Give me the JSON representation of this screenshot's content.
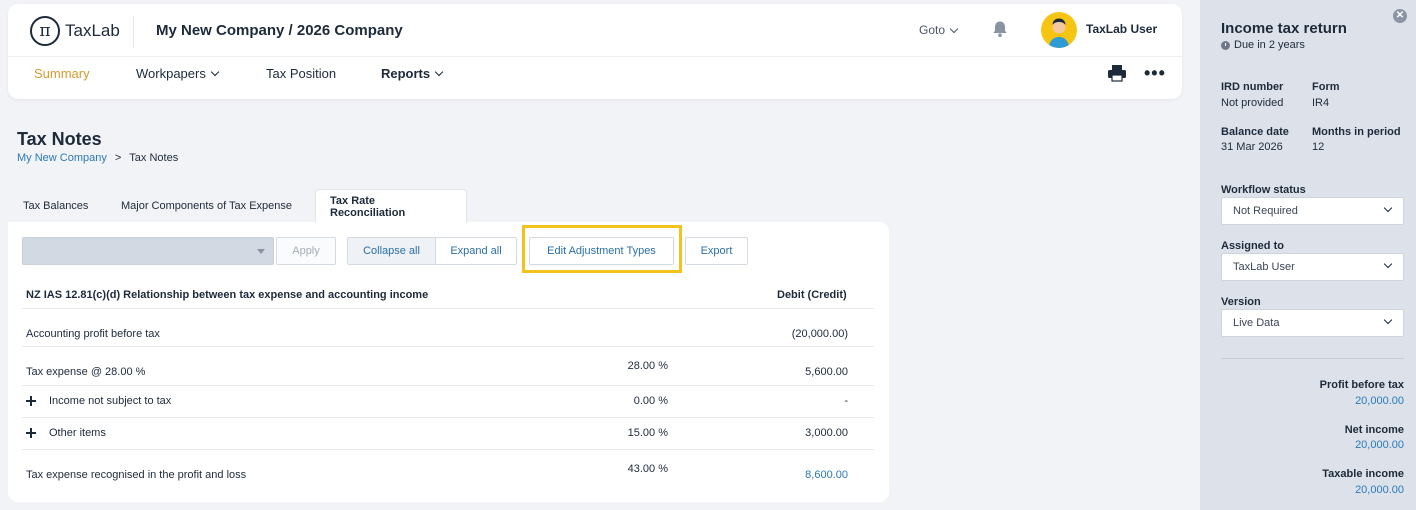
{
  "header": {
    "logo_text": "TaxLab",
    "company_title": "My New Company / 2026 Company",
    "goto_label": "Goto",
    "user_name": "TaxLab User"
  },
  "nav": [
    {
      "label": "Summary"
    },
    {
      "label": "Workpapers"
    },
    {
      "label": "Tax Position"
    },
    {
      "label": "Reports"
    }
  ],
  "page": {
    "title": "Tax Notes",
    "breadcrumb": [
      "My New Company",
      ">",
      "Tax Notes"
    ]
  },
  "tabs": [
    {
      "label": "Tax Balances"
    },
    {
      "label": "Major Components of Tax Expense"
    },
    {
      "label": "Tax Rate Reconciliation"
    }
  ],
  "toolbar": {
    "apply": "Apply",
    "collapse_all": "Collapse all",
    "expand_all": "Expand all",
    "edit_adjustment_types": "Edit Adjustment Types",
    "export": "Export"
  },
  "table": {
    "heading": "NZ IAS 12.81(c)(d) Relationship between tax expense and accounting income",
    "col_header": "Debit (Credit)",
    "rows": [
      {
        "label": "Accounting profit before tax",
        "pct": "",
        "value": "(20,000.00)"
      },
      {
        "label": "Tax expense @ 28.00 %",
        "pct": "28.00 %",
        "value": "5,600.00"
      },
      {
        "label": "Income not subject to tax",
        "pct": "0.00 %",
        "value": "-"
      },
      {
        "label": "Other items",
        "pct": "15.00 %",
        "value": "3,000.00"
      },
      {
        "label": "Tax expense recognised in the profit and loss",
        "pct": "43.00 %",
        "value": "8,600.00"
      }
    ]
  },
  "panel": {
    "title": "Income tax return",
    "due": "Due in 2 years",
    "ird_label": "IRD number",
    "ird_value": "Not provided",
    "form_label": "Form",
    "form_value": "IR4",
    "balance_label": "Balance date",
    "balance_value": "31 Mar 2026",
    "months_label": "Months in period",
    "months_value": "12",
    "workflow_label": "Workflow status",
    "workflow_value": "Not Required",
    "assigned_label": "Assigned to",
    "assigned_value": "TaxLab User",
    "version_label": "Version",
    "version_value": "Live Data",
    "profit_label": "Profit before tax",
    "profit_value": "20,000.00",
    "net_label": "Net income",
    "net_value": "20,000.00",
    "taxable_label": "Taxable income",
    "taxable_value": "20,000.00"
  },
  "colors": {
    "accent": "#d69a2d",
    "link": "#2a7ab8",
    "highlight": "#f2c31c",
    "panel_bg": "#dde2ea"
  },
  "icons": [
    "logo-icon",
    "bell-icon",
    "avatar-icon",
    "printer-icon",
    "more-icon",
    "chevron-down-icon",
    "plus-icon",
    "clock-icon",
    "close-icon"
  ]
}
